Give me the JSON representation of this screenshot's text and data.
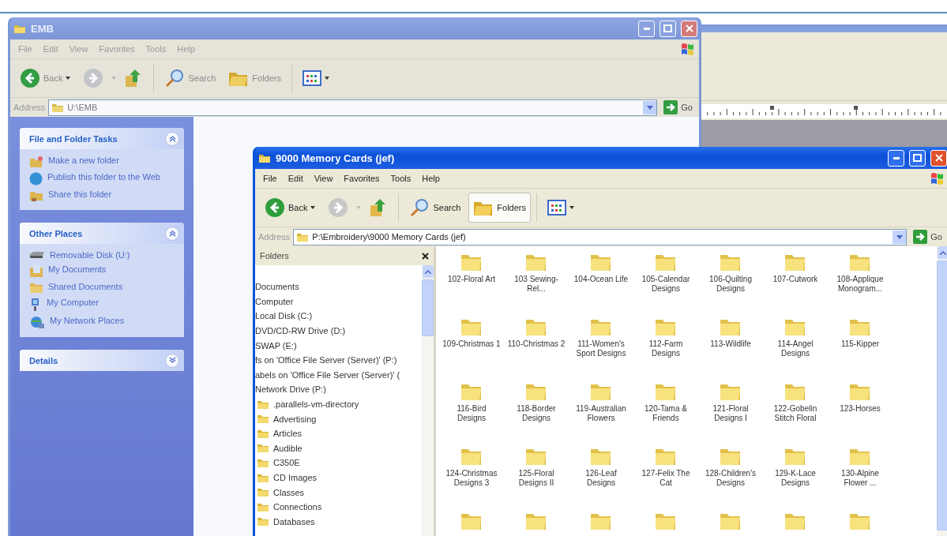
{
  "windows": [
    {
      "title": "EMB",
      "active": false,
      "menu": [
        "File",
        "Edit",
        "View",
        "Favorites",
        "Tools",
        "Help"
      ],
      "toolbar": {
        "back": "Back",
        "search": "Search",
        "folders": "Folders",
        "folders_on": false
      },
      "address": {
        "label": "Address",
        "value": "U:\\EMB",
        "go": "Go"
      },
      "task_panels": [
        {
          "title": "File and Folder Tasks",
          "expanded": true,
          "items": [
            {
              "kind": "new-folder",
              "label": "Make a new folder"
            },
            {
              "kind": "globe",
              "label": "Publish this folder to the Web"
            },
            {
              "kind": "share",
              "label": "Share this folder"
            }
          ]
        },
        {
          "title": "Other Places",
          "expanded": true,
          "items": [
            {
              "kind": "disk",
              "label": "Removable Disk (U:)"
            },
            {
              "kind": "documents",
              "label": "My Documents"
            },
            {
              "kind": "folder",
              "label": "Shared Documents"
            },
            {
              "kind": "computer",
              "label": "My Computer"
            },
            {
              "kind": "network",
              "label": "My Network Places"
            }
          ]
        },
        {
          "title": "Details",
          "expanded": false
        }
      ]
    },
    {
      "title": "9000 Memory Cards (jef)",
      "active": true,
      "menu": [
        "File",
        "Edit",
        "View",
        "Favorites",
        "Tools",
        "Help"
      ],
      "toolbar": {
        "back": "Back",
        "search": "Search",
        "folders": "Folders",
        "folders_on": true
      },
      "address": {
        "label": "Address",
        "value": "P:\\Embroidery\\9000 Memory Cards (jef)",
        "go": "Go"
      },
      "folders_pane": {
        "title": "Folders",
        "tree": [
          {
            "kind": "text",
            "label": "Documents"
          },
          {
            "kind": "text",
            "label": "Computer"
          },
          {
            "kind": "text",
            "label": "Local Disk (C:)"
          },
          {
            "kind": "text",
            "label": "DVD/CD-RW Drive (D:)"
          },
          {
            "kind": "text",
            "label": "SWAP (E:)"
          },
          {
            "kind": "text",
            "label": "fs on 'Office File Server (Server)' (P:)"
          },
          {
            "kind": "text",
            "label": "abels on 'Office File Server (Server)' ("
          },
          {
            "kind": "text",
            "label": "Network Drive (P:)"
          },
          {
            "kind": "folder",
            "label": ".parallels-vm-directory"
          },
          {
            "kind": "folder",
            "label": "Advertising"
          },
          {
            "kind": "folder",
            "label": "Articles"
          },
          {
            "kind": "folder",
            "label": "Audible"
          },
          {
            "kind": "folder",
            "label": "C350E"
          },
          {
            "kind": "folder",
            "label": "CD Images"
          },
          {
            "kind": "folder",
            "label": "Classes"
          },
          {
            "kind": "folder",
            "label": "Connections"
          },
          {
            "kind": "folder",
            "label": "Databases"
          }
        ]
      },
      "items": [
        {
          "kind": "folder",
          "label": "102-Floral Art"
        },
        {
          "kind": "folder",
          "label": "103 Sewing-Rel..."
        },
        {
          "kind": "folder",
          "label": "104-Ocean Life"
        },
        {
          "kind": "folder",
          "label": "105-Calendar Designs"
        },
        {
          "kind": "folder",
          "label": "106-Quilting Designs"
        },
        {
          "kind": "folder",
          "label": "107-Cutwork"
        },
        {
          "kind": "folder",
          "label": "108-Applique Monogram..."
        },
        {
          "kind": "folder",
          "label": "109-Christmas 1"
        },
        {
          "kind": "folder",
          "label": "110-Christmas 2"
        },
        {
          "kind": "folder",
          "label": "111-Women's Sport Designs"
        },
        {
          "kind": "folder",
          "label": "112-Farm Designs"
        },
        {
          "kind": "folder",
          "label": "113-Wildlife"
        },
        {
          "kind": "folder",
          "label": "114-Angel Designs"
        },
        {
          "kind": "folder",
          "label": "115-Kipper"
        },
        {
          "kind": "folder",
          "label": "116-Bird Designs"
        },
        {
          "kind": "folder",
          "label": "118-Border Designs"
        },
        {
          "kind": "folder",
          "label": "119-Australian Flowers"
        },
        {
          "kind": "folder",
          "label": "120-Tama & Friends"
        },
        {
          "kind": "folder",
          "label": "121-Floral Designs I"
        },
        {
          "kind": "folder",
          "label": "122-Gobelin Stitch Floral"
        },
        {
          "kind": "folder",
          "label": "123-Horses"
        },
        {
          "kind": "folder",
          "label": "124-Christmas Designs 3"
        },
        {
          "kind": "folder",
          "label": "125-Floral Designs II"
        },
        {
          "kind": "folder",
          "label": "126-Leaf Designs"
        },
        {
          "kind": "folder",
          "label": "127-Felix The Cat"
        },
        {
          "kind": "folder",
          "label": "128-Children's Designs"
        },
        {
          "kind": "folder",
          "label": "129-K-Lace Designs"
        },
        {
          "kind": "folder",
          "label": "130-Alpine Flower ..."
        },
        {
          "kind": "folder"
        },
        {
          "kind": "folder"
        },
        {
          "kind": "folder"
        },
        {
          "kind": "folder"
        },
        {
          "kind": "folder"
        },
        {
          "kind": "folder"
        },
        {
          "kind": "folder"
        }
      ]
    }
  ]
}
